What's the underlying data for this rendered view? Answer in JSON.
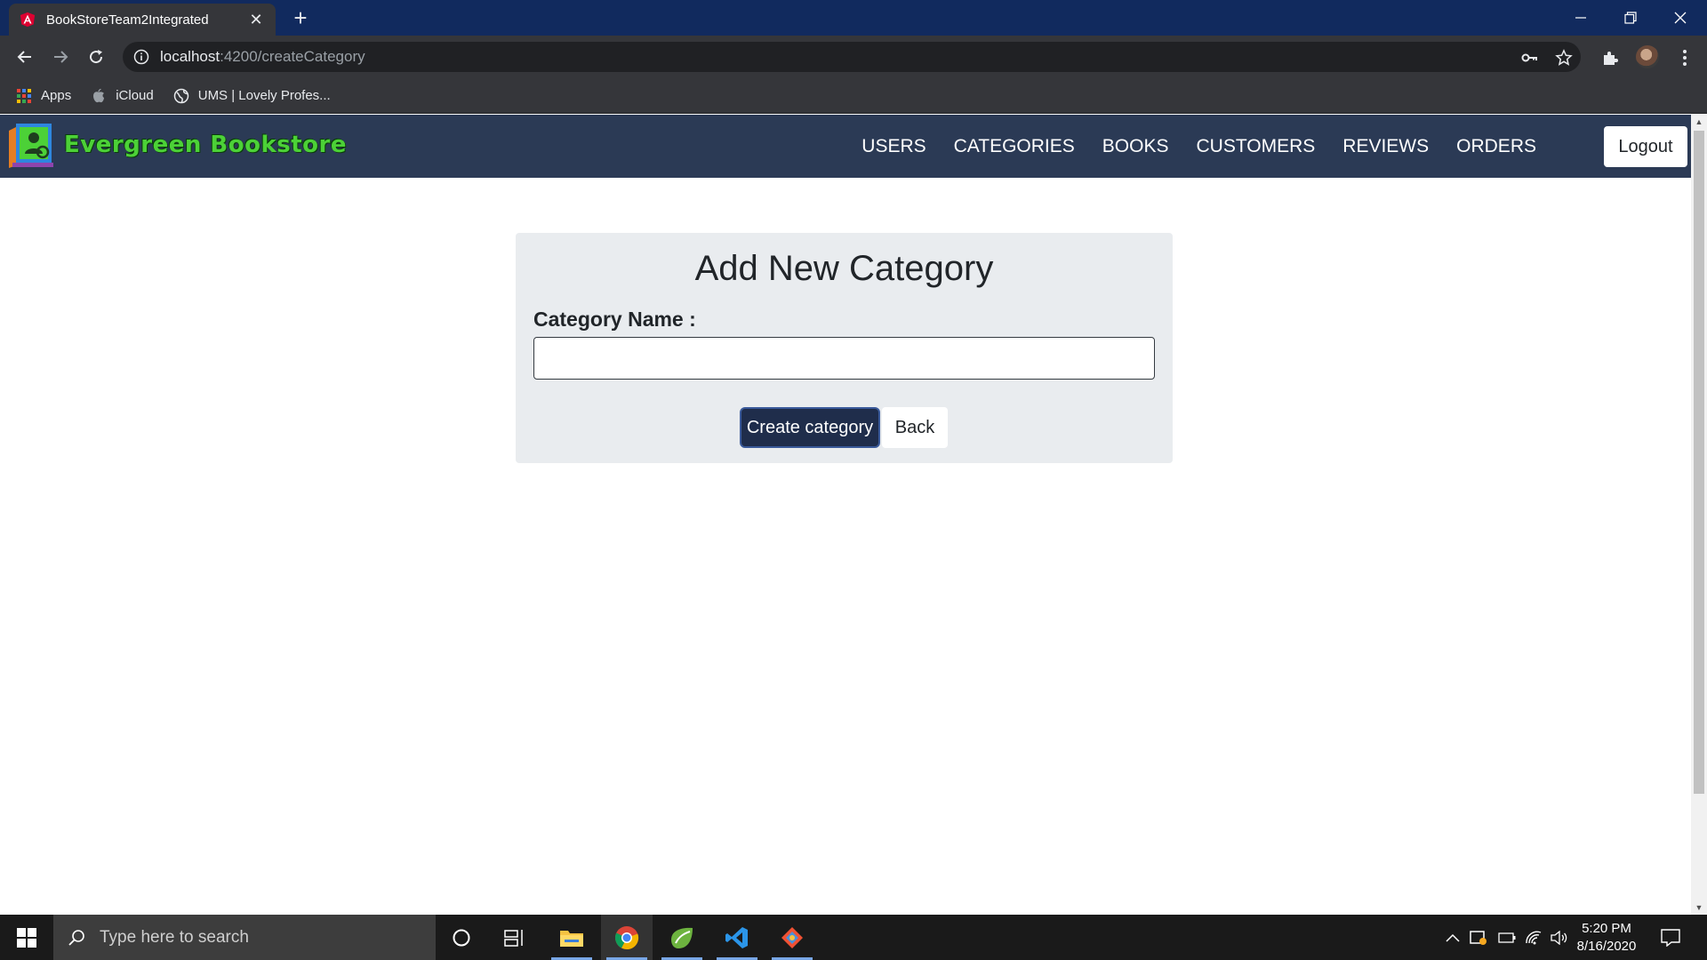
{
  "browser": {
    "tab_title": "BookStoreTeam2Integrated",
    "url_host": "localhost",
    "url_path": ":4200/createCategory",
    "bookmarks": [
      {
        "label": "Apps",
        "icon": "apps-grid-icon"
      },
      {
        "label": "iCloud",
        "icon": "apple-icon"
      },
      {
        "label": "UMS | Lovely Profes...",
        "icon": "globe-icon"
      }
    ]
  },
  "app": {
    "brand": "Evergreen Bookstore",
    "nav": [
      "USERS",
      "CATEGORIES",
      "BOOKS",
      "CUSTOMERS",
      "REVIEWS",
      "ORDERS"
    ],
    "logout": "Logout"
  },
  "form": {
    "title": "Add New Category",
    "category_label": "Category Name :",
    "category_value": "",
    "create_button": "Create category",
    "back_button": "Back"
  },
  "taskbar": {
    "search_placeholder": "Type here to search",
    "time": "5:20 PM",
    "date": "8/16/2020"
  },
  "colors": {
    "titlebar": "#112a5e",
    "app_nav": "#2b3a55",
    "brand_green": "#4cd137",
    "primary_button": "#1f2d4b"
  }
}
